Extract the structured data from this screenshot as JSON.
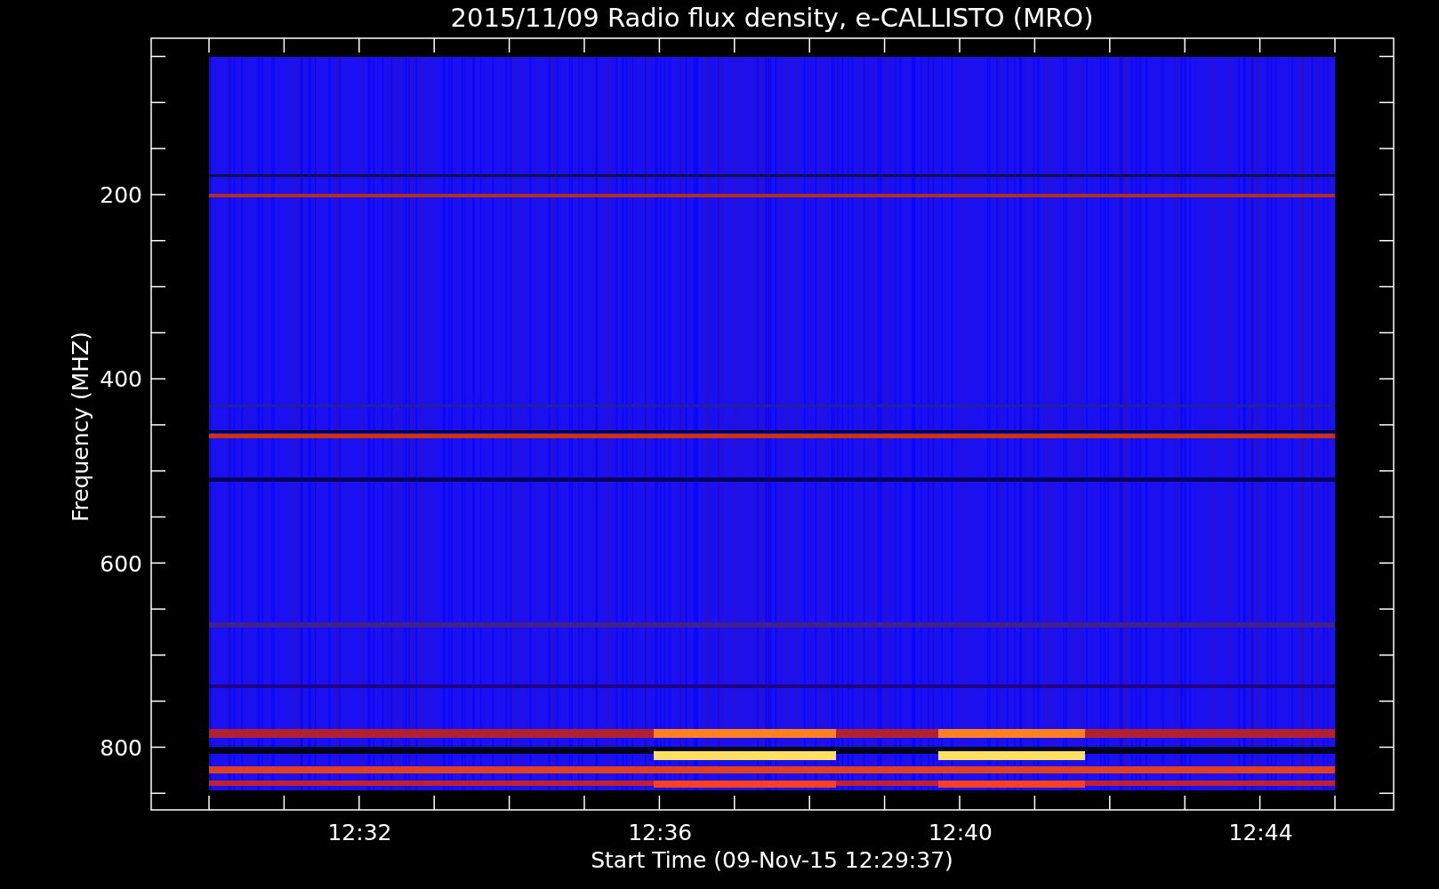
{
  "title": "2015/11/09  Radio flux density, e-CALLISTO (MRO)",
  "y_axis": {
    "label": "Frequency (MHZ)",
    "ticks": [
      "200",
      "400",
      "600",
      "800"
    ]
  },
  "x_axis": {
    "label": "Start Time (09-Nov-15 12:29:37)",
    "ticks": [
      "12:32",
      "12:36",
      "12:40",
      "12:44"
    ]
  }
}
